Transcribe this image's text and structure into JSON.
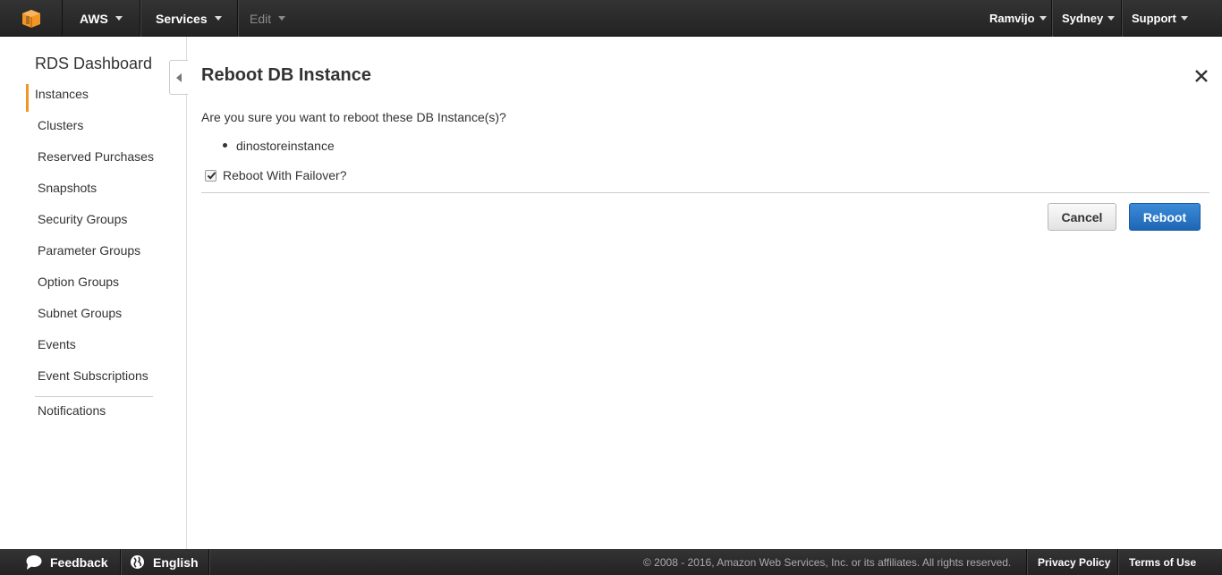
{
  "topnav": {
    "brand": "AWS",
    "services": "Services",
    "edit": "Edit",
    "user": "Ramvijo",
    "region": "Sydney",
    "support": "Support"
  },
  "sidebar": {
    "title": "RDS Dashboard",
    "items": [
      {
        "label": "Instances",
        "active": true
      },
      {
        "label": "Clusters"
      },
      {
        "label": "Reserved Purchases"
      },
      {
        "label": "Snapshots"
      },
      {
        "label": "Security Groups"
      },
      {
        "label": "Parameter Groups"
      },
      {
        "label": "Option Groups"
      },
      {
        "label": "Subnet Groups"
      },
      {
        "label": "Events"
      },
      {
        "label": "Event Subscriptions"
      }
    ],
    "extra_item": "Notifications"
  },
  "dialog": {
    "title": "Reboot DB Instance",
    "confirm_text": "Are you sure you want to reboot these DB Instance(s)?",
    "instances": [
      "dinostoreinstance"
    ],
    "failover_label": "Reboot With Failover?",
    "failover_checked": true,
    "cancel_label": "Cancel",
    "reboot_label": "Reboot"
  },
  "footer": {
    "feedback": "Feedback",
    "language": "English",
    "copyright": "© 2008 - 2016, Amazon Web Services, Inc. or its affiliates. All rights reserved.",
    "privacy": "Privacy Policy",
    "terms": "Terms of Use"
  },
  "colors": {
    "accent_orange": "#f29524",
    "primary_button": "#1f66b5",
    "nav_background": "#232323"
  }
}
